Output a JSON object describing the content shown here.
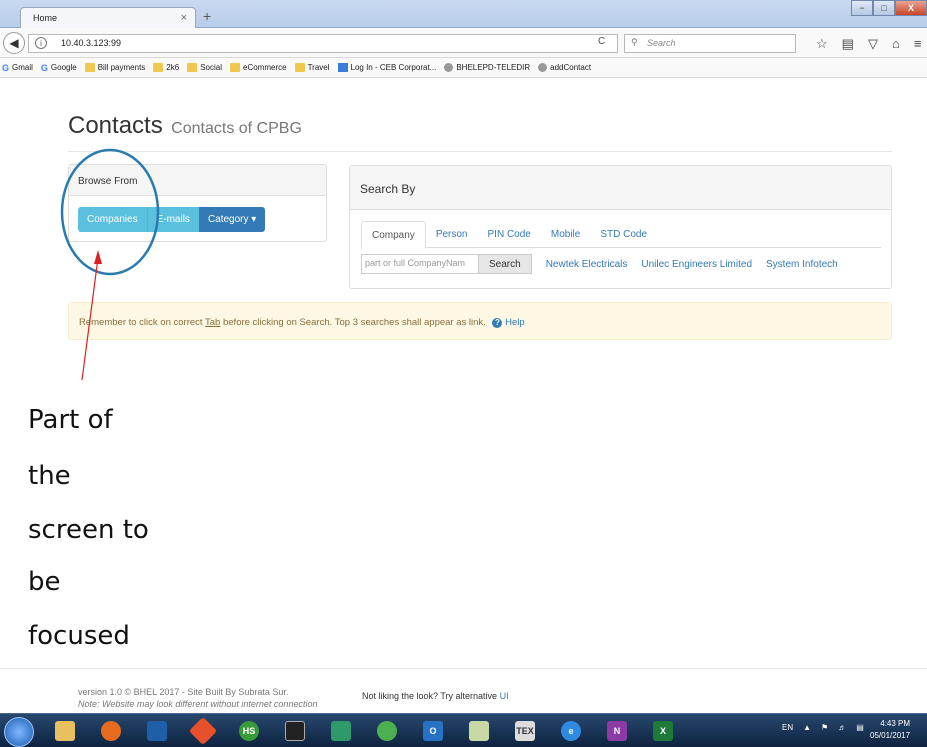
{
  "browser": {
    "tab_title": "Home",
    "tab_close": "×",
    "new_tab": "+",
    "url": "10.40.3.123:99",
    "search_placeholder": "Search",
    "window_controls": [
      "−",
      "□",
      "X"
    ],
    "bookmarks": [
      {
        "icon": "google-icon",
        "label": "Gmail"
      },
      {
        "icon": "google-icon",
        "label": "Google"
      },
      {
        "icon": "folder-icon",
        "label": "Bill payments"
      },
      {
        "icon": "folder-icon",
        "label": "2k6"
      },
      {
        "icon": "folder-icon",
        "label": "Social"
      },
      {
        "icon": "folder-icon",
        "label": "eCommerce"
      },
      {
        "icon": "folder-icon",
        "label": "Travel"
      },
      {
        "icon": "ceb-icon",
        "label": "Log In - CEB Corporat..."
      },
      {
        "icon": "globe-icon",
        "label": "BHELEPD-TELEDIR"
      },
      {
        "icon": "globe-icon",
        "label": "addContact"
      }
    ]
  },
  "page": {
    "title": "Contacts",
    "subtitle": "Contacts of CPBG",
    "browse": {
      "heading": "Browse From",
      "buttons": {
        "companies": "Companies",
        "emails": "E-mails",
        "category": "Category ▾"
      }
    },
    "search": {
      "heading": "Search By",
      "tabs": [
        "Company",
        "Person",
        "PIN Code",
        "Mobile",
        "STD Code"
      ],
      "input_placeholder": "part or full CompanyNam",
      "button": "Search",
      "quick_links": [
        "Newtek Electricals",
        "Unilec Engineers Limited",
        "System Infotech"
      ]
    },
    "alert": {
      "text_before": "Remember to click on correct ",
      "tab_word": "Tab",
      "text_after": " before clicking on Search. Top 3 searches shall appear as link.",
      "help": "Help"
    },
    "footer": {
      "version": "version 1.0 © BHEL 2017 - Site Built By Subrata Sur.",
      "note": "Note: Website may look different without internet connection",
      "alt_text": "Not liking the look? Try alternative ",
      "alt_link": "UI"
    }
  },
  "annotation": {
    "lines": [
      "Part of",
      "the",
      "screen to",
      "be",
      "focused"
    ],
    "color": "#e02020",
    "circle_color": "#2a7ab0"
  },
  "taskbar": {
    "language": "EN",
    "time": "4:43 PM",
    "date": "05/01/2017"
  }
}
